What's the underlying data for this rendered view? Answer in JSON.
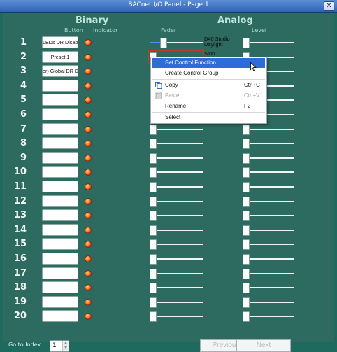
{
  "window": {
    "title": "BACnet I/O Panel - Page 1",
    "close_label": "✕"
  },
  "headers": {
    "binary": "Binary",
    "button": "Button",
    "indicator": "Indicator",
    "analog": "Analog",
    "fader": "Fader",
    "level": "Level"
  },
  "rows": [
    {
      "num": "1",
      "button": "LEDs DR Disable",
      "fader_label": "D40 Studio Daylight",
      "fader_level": 0.2,
      "level_value": 0.0
    },
    {
      "num": "2",
      "button": "Preset 1",
      "fader_label": "Stun",
      "fader_level": 0.0,
      "level_value": 0.0
    },
    {
      "num": "3",
      "button": "er) Global DR Dis",
      "fader_label": "",
      "fader_level": 0.0,
      "level_value": 0.0
    },
    {
      "num": "4",
      "button": "",
      "fader_label": "",
      "fader_level": 0.0,
      "level_value": 0.0
    },
    {
      "num": "5",
      "button": "",
      "fader_label": "",
      "fader_level": 0.0,
      "level_value": 0.0
    },
    {
      "num": "6",
      "button": "",
      "fader_label": "",
      "fader_level": 0.0,
      "level_value": 0.0
    },
    {
      "num": "7",
      "button": "",
      "fader_label": "",
      "fader_level": 0.0,
      "level_value": 0.0
    },
    {
      "num": "8",
      "button": "",
      "fader_label": "",
      "fader_level": 0.0,
      "level_value": 0.0
    },
    {
      "num": "9",
      "button": "",
      "fader_label": "",
      "fader_level": 0.0,
      "level_value": 0.0
    },
    {
      "num": "10",
      "button": "",
      "fader_label": "",
      "fader_level": 0.0,
      "level_value": 0.0
    },
    {
      "num": "11",
      "button": "",
      "fader_label": "",
      "fader_level": 0.0,
      "level_value": 0.0
    },
    {
      "num": "12",
      "button": "",
      "fader_label": "",
      "fader_level": 0.0,
      "level_value": 0.0
    },
    {
      "num": "13",
      "button": "",
      "fader_label": "",
      "fader_level": 0.0,
      "level_value": 0.0
    },
    {
      "num": "14",
      "button": "",
      "fader_label": "",
      "fader_level": 0.0,
      "level_value": 0.0
    },
    {
      "num": "15",
      "button": "",
      "fader_label": "",
      "fader_level": 0.0,
      "level_value": 0.0
    },
    {
      "num": "16",
      "button": "",
      "fader_label": "",
      "fader_level": 0.0,
      "level_value": 0.0
    },
    {
      "num": "17",
      "button": "",
      "fader_label": "",
      "fader_level": 0.0,
      "level_value": 0.0
    },
    {
      "num": "18",
      "button": "",
      "fader_label": "",
      "fader_level": 0.0,
      "level_value": 0.0
    },
    {
      "num": "19",
      "button": "",
      "fader_label": "",
      "fader_level": 0.0,
      "level_value": 0.0
    },
    {
      "num": "20",
      "button": "",
      "fader_label": "",
      "fader_level": 0.0,
      "level_value": 0.0
    }
  ],
  "context_menu": {
    "items": [
      {
        "label": "Set Control Function",
        "shortcut": "",
        "icon": "",
        "state": "highlighted"
      },
      {
        "label": "Create Control Group",
        "shortcut": "",
        "icon": "",
        "state": "normal"
      },
      {
        "label": "Copy",
        "shortcut": "Ctrl+C",
        "icon": "copy-icon",
        "state": "normal"
      },
      {
        "label": "Paste",
        "shortcut": "Ctrl+V",
        "icon": "paste-icon",
        "state": "disabled"
      },
      {
        "label": "Rename",
        "shortcut": "F2",
        "icon": "",
        "state": "normal"
      },
      {
        "label": "Select",
        "shortcut": "",
        "icon": "",
        "state": "normal"
      }
    ]
  },
  "footer": {
    "goto_label": "Go to Index",
    "index_value": "1",
    "previous_label": "Previous",
    "next_label": "Next"
  },
  "colors": {
    "background": "#2d6a5f",
    "titlebar": "#2f62b3",
    "menu_highlight": "#2f6cd7",
    "led": "#ff5a1f"
  }
}
